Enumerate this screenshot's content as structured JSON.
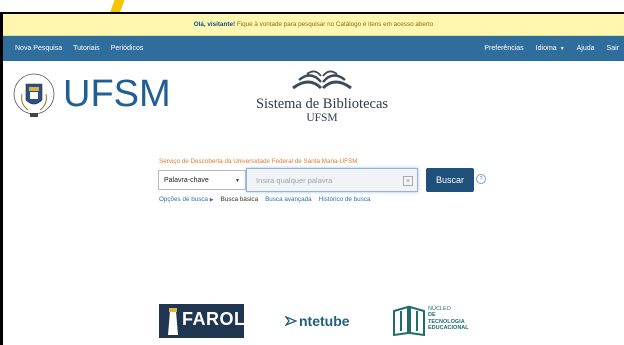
{
  "notice": {
    "greeting": "Olá, visitante!",
    "message": " Fique à vontade para pesquisar no Catálogo e itens em acesso aberto"
  },
  "nav": {
    "left": [
      "Nova Pesquisa",
      "Tutoriais",
      "Periódicos"
    ],
    "right": {
      "preferences": "Preferências",
      "language": "Idioma",
      "help": "Ajuda",
      "exit": "Sair"
    }
  },
  "header": {
    "logo_text": "UFSM",
    "library_title": "Sistema de Bibliotecas",
    "library_subtitle": "UFSM"
  },
  "search": {
    "heading": "Serviço de Descoberta da Universidade Federal de Santa Maria-UFSM",
    "scope_selected": "Palavra-chave",
    "placeholder": "Insira qualquer palavra",
    "button": "Buscar",
    "links": {
      "options": "Opções de busca",
      "basic": "Busca básica",
      "advanced": "Busca avançada",
      "history": "Histórico de busca"
    }
  },
  "footer_logos": {
    "farol": "FAROL",
    "nte": "ntetube",
    "nucleo_line1": "NÚCLEO",
    "nucleo_line2": "DE TECNOLOGIA",
    "nucleo_line3": "EDUCACIONAL"
  },
  "colors": {
    "navbar": "#2f6e9c",
    "notice_bg": "#fff7b0",
    "brand_blue": "#1f5f95",
    "button": "#1f5079",
    "heading_orange": "#e07a30"
  }
}
